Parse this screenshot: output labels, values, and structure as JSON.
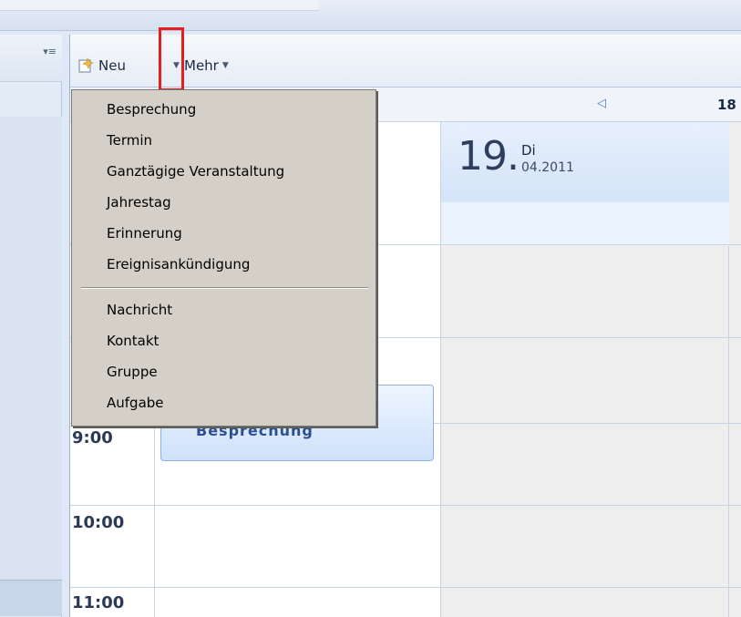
{
  "toolbar": {
    "new_label": "Neu",
    "more_label": "Mehr"
  },
  "calendar": {
    "next_day_partial": "18",
    "day": {
      "number": "19.",
      "weekday": "Di",
      "month_year": "04.2011"
    },
    "times": [
      "9:00",
      "10:00",
      "11:00"
    ],
    "event_title": "Besprechung"
  },
  "menu": {
    "group1": [
      "Besprechung",
      "Termin",
      "Ganztägige Veranstaltung",
      "Jahrestag",
      "Erinnerung",
      "Ereignisankündigung"
    ],
    "group2": [
      "Nachricht",
      "Kontakt",
      "Gruppe",
      "Aufgabe"
    ]
  },
  "icons": {
    "new": "new-item-icon",
    "dropdown": "chevron-down-icon",
    "nav_prev": "triangle-left-icon",
    "collapse": "collapse-menu-icon"
  },
  "colors": {
    "highlight_box": "#e32020",
    "menu_bg": "#d4d0c8",
    "event_bg": "#cfe1fb"
  }
}
